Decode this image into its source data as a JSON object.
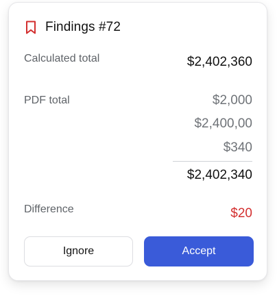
{
  "header": {
    "title": "Findings #72",
    "icon": "bookmark-icon",
    "icon_color": "#d32f2f"
  },
  "calculated": {
    "label": "Calculated total",
    "value": "$2,402,360"
  },
  "pdf": {
    "label": "PDF total",
    "items": [
      "$2,000",
      "$2,400,00",
      "$340"
    ],
    "total": "$2,402,340"
  },
  "difference": {
    "label": "Difference",
    "value": "$20",
    "color": "#d32f2f"
  },
  "actions": {
    "ignore_label": "Ignore",
    "accept_label": "Accept",
    "accept_color": "#3a5bd9"
  }
}
